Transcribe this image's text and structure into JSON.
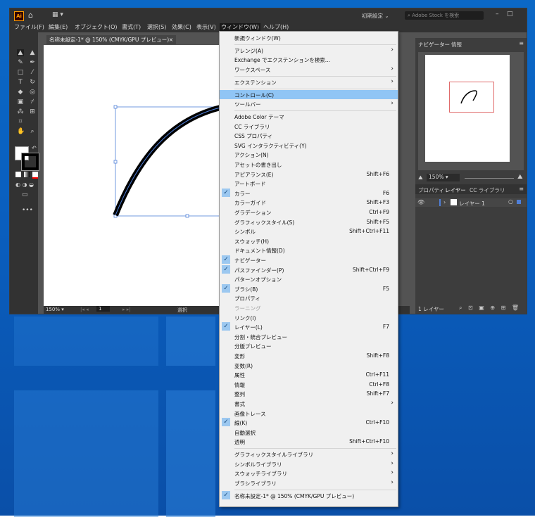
{
  "app": {
    "logo": "Ai",
    "workspace": "初期設定",
    "search_placeholder": "Adobe Stock を検索"
  },
  "menubar": [
    "ファイル(F)",
    "編集(E)",
    "オブジェクト(O)",
    "書式(T)",
    "選択(S)",
    "効果(C)",
    "表示(V)",
    "ウィンドウ(W)",
    "ヘルプ(H)"
  ],
  "doc_tab": "名称未設定-1* @ 150% (CMYK/GPU プレビュー)",
  "doc_tab_close": "×",
  "status": {
    "zoom": "150%",
    "page": "1",
    "tool": "選択"
  },
  "right_panel": {
    "tabs_top": [
      "ナビゲーター",
      "情報"
    ],
    "nav_zoom": "150%",
    "tabs_bottom": [
      "プロパティ",
      "レイヤー",
      "CC ライブラリ"
    ],
    "layer_name": "レイヤー 1",
    "layer_count": "1 レイヤー"
  },
  "menu_items": [
    {
      "label": "新規ウィンドウ(W)",
      "shortcut": "",
      "submenu": false,
      "checked": false
    },
    {
      "sep": true
    },
    {
      "label": "アレンジ(A)",
      "shortcut": "",
      "submenu": true,
      "checked": false
    },
    {
      "label": "Exchange でエクステンションを検索...",
      "shortcut": "",
      "submenu": false,
      "checked": false
    },
    {
      "label": "ワークスペース",
      "shortcut": "",
      "submenu": true,
      "checked": false
    },
    {
      "sep": true
    },
    {
      "label": "エクステンション",
      "shortcut": "",
      "submenu": true,
      "checked": false
    },
    {
      "sep": true
    },
    {
      "label": "コントロール(C)",
      "shortcut": "",
      "submenu": false,
      "checked": false,
      "highlight": true
    },
    {
      "label": "ツールバー",
      "shortcut": "",
      "submenu": true,
      "checked": false
    },
    {
      "sep": true
    },
    {
      "label": "Adobe Color テーマ",
      "shortcut": "",
      "submenu": false,
      "checked": false
    },
    {
      "label": "CC ライブラリ",
      "shortcut": "",
      "submenu": false,
      "checked": false
    },
    {
      "label": "CSS プロパティ",
      "shortcut": "",
      "submenu": false,
      "checked": false
    },
    {
      "label": "SVG インタラクティビティ(Y)",
      "shortcut": "",
      "submenu": false,
      "checked": false
    },
    {
      "label": "アクション(N)",
      "shortcut": "",
      "submenu": false,
      "checked": false
    },
    {
      "label": "アセットの書き出し",
      "shortcut": "",
      "submenu": false,
      "checked": false
    },
    {
      "label": "アピアランス(E)",
      "shortcut": "Shift+F6",
      "submenu": false,
      "checked": false
    },
    {
      "label": "アートボード",
      "shortcut": "",
      "submenu": false,
      "checked": false
    },
    {
      "label": "カラー",
      "shortcut": "F6",
      "submenu": false,
      "checked": true
    },
    {
      "label": "カラーガイド",
      "shortcut": "Shift+F3",
      "submenu": false,
      "checked": false
    },
    {
      "label": "グラデーション",
      "shortcut": "Ctrl+F9",
      "submenu": false,
      "checked": false
    },
    {
      "label": "グラフィックスタイル(S)",
      "shortcut": "Shift+F5",
      "submenu": false,
      "checked": false
    },
    {
      "label": "シンボル",
      "shortcut": "Shift+Ctrl+F11",
      "submenu": false,
      "checked": false
    },
    {
      "label": "スウォッチ(H)",
      "shortcut": "",
      "submenu": false,
      "checked": false
    },
    {
      "label": "ドキュメント情報(D)",
      "shortcut": "",
      "submenu": false,
      "checked": false
    },
    {
      "label": "ナビゲーター",
      "shortcut": "",
      "submenu": false,
      "checked": true
    },
    {
      "label": "パスファインダー(P)",
      "shortcut": "Shift+Ctrl+F9",
      "submenu": false,
      "checked": true
    },
    {
      "label": "パターンオプション",
      "shortcut": "",
      "submenu": false,
      "checked": false
    },
    {
      "label": "ブラシ(B)",
      "shortcut": "F5",
      "submenu": false,
      "checked": true
    },
    {
      "label": "プロパティ",
      "shortcut": "",
      "submenu": false,
      "checked": false
    },
    {
      "label": "ラーニング",
      "shortcut": "",
      "submenu": false,
      "checked": false,
      "disabled": true
    },
    {
      "label": "リンク(I)",
      "shortcut": "",
      "submenu": false,
      "checked": false
    },
    {
      "label": "レイヤー(L)",
      "shortcut": "F7",
      "submenu": false,
      "checked": true
    },
    {
      "label": "分割・統合プレビュー",
      "shortcut": "",
      "submenu": false,
      "checked": false
    },
    {
      "label": "分版プレビュー",
      "shortcut": "",
      "submenu": false,
      "checked": false
    },
    {
      "label": "変形",
      "shortcut": "Shift+F8",
      "submenu": false,
      "checked": false
    },
    {
      "label": "変数(R)",
      "shortcut": "",
      "submenu": false,
      "checked": false
    },
    {
      "label": "属性",
      "shortcut": "Ctrl+F11",
      "submenu": false,
      "checked": false
    },
    {
      "label": "情報",
      "shortcut": "Ctrl+F8",
      "submenu": false,
      "checked": false
    },
    {
      "label": "整列",
      "shortcut": "Shift+F7",
      "submenu": false,
      "checked": false
    },
    {
      "label": "書式",
      "shortcut": "",
      "submenu": true,
      "checked": false
    },
    {
      "label": "画像トレース",
      "shortcut": "",
      "submenu": false,
      "checked": false
    },
    {
      "label": "線(K)",
      "shortcut": "Ctrl+F10",
      "submenu": false,
      "checked": true
    },
    {
      "label": "自動選択",
      "shortcut": "",
      "submenu": false,
      "checked": false
    },
    {
      "label": "透明",
      "shortcut": "Shift+Ctrl+F10",
      "submenu": false,
      "checked": false
    },
    {
      "sep": true
    },
    {
      "label": "グラフィックスタイルライブラリ",
      "shortcut": "",
      "submenu": true,
      "checked": false
    },
    {
      "label": "シンボルライブラリ",
      "shortcut": "",
      "submenu": true,
      "checked": false
    },
    {
      "label": "スウォッチライブラリ",
      "shortcut": "",
      "submenu": true,
      "checked": false
    },
    {
      "label": "ブラシライブラリ",
      "shortcut": "",
      "submenu": true,
      "checked": false
    },
    {
      "sep": true
    },
    {
      "label": "名称未設定-1* @ 150% (CMYK/GPU プレビュー)",
      "shortcut": "",
      "submenu": false,
      "checked": true
    }
  ],
  "colors": {
    "highlight": "#90c5f5",
    "check_bg": "#9cc8f0",
    "ui_dark": "#323232",
    "desktop": "#0a5fbf"
  }
}
